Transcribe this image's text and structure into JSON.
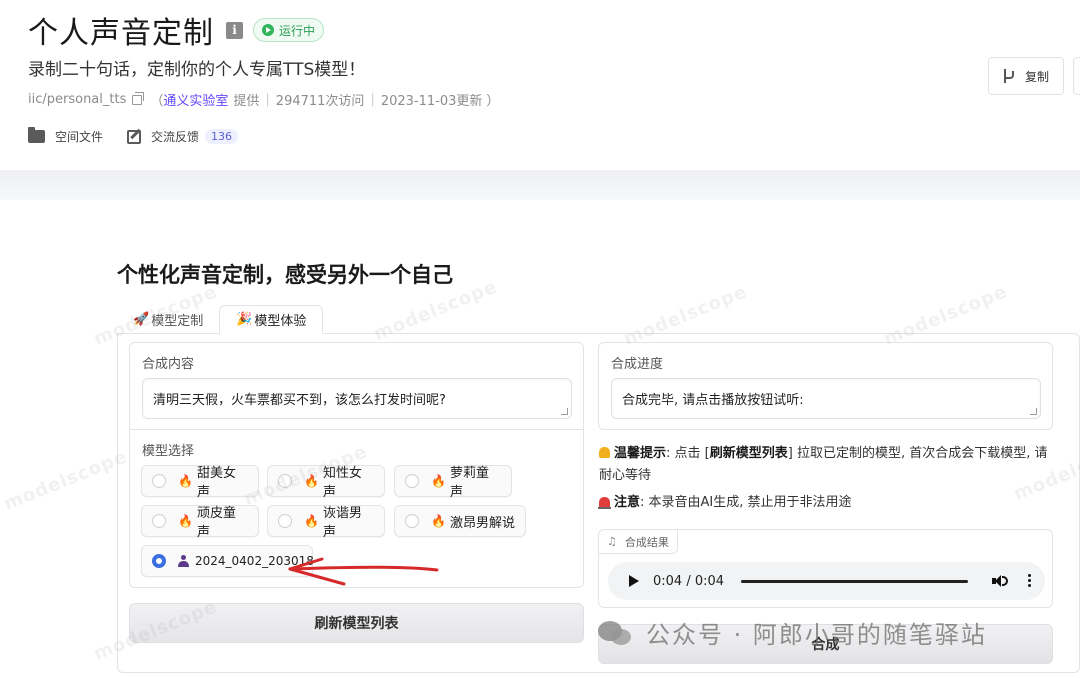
{
  "header": {
    "title": "个人声音定制",
    "info_glyph": "i",
    "status": "运行中",
    "subtitle": "录制二十句话，定制你的个人专属TTS模型！",
    "model_id": "iic/personal_tts",
    "provider_open": "（",
    "provider_name": "通义实验室",
    "provider_suffix": "提供",
    "visits": "294711次访问",
    "updated": "2023-11-03更新",
    "close_paren": "）",
    "links": {
      "files": "空间文件",
      "feedback": "交流反馈",
      "feedback_count": "136"
    },
    "duplicate_button": "复制"
  },
  "app": {
    "title": "个性化声音定制，感受另外一个自己",
    "tabs": [
      {
        "emoji": "🚀",
        "label": "模型定制",
        "active": false
      },
      {
        "emoji": "🎉",
        "label": "模型体验",
        "active": true
      }
    ],
    "synth_content": {
      "label": "合成内容",
      "value": "清明三天假，火车票都买不到，该怎么打发时间呢?"
    },
    "model_select": {
      "label": "模型选择",
      "options": [
        {
          "label": "甜美女声",
          "icon": "fire-icon",
          "selected": false
        },
        {
          "label": "知性女声",
          "icon": "fire-icon",
          "selected": false
        },
        {
          "label": "萝莉童声",
          "icon": "fire-icon",
          "selected": false
        },
        {
          "label": "顽皮童声",
          "icon": "fire-icon",
          "selected": false
        },
        {
          "label": "诙谐男声",
          "icon": "fire-icon",
          "selected": false
        },
        {
          "label": "激昂男解说",
          "icon": "fire-icon",
          "selected": false
        },
        {
          "label": "2024_0402_203018",
          "icon": "user-icon",
          "selected": true
        }
      ]
    },
    "refresh_button": "刷新模型列表",
    "progress": {
      "label": "合成进度",
      "value": "合成完毕, 请点击播放按钮试听:"
    },
    "tips": {
      "warm_label": "温馨提示",
      "warm_pre": ": 点击 [",
      "warm_bold": "刷新模型列表",
      "warm_post": "] 拉取已定制的模型, 首次合成会下载模型, 请耐心等待",
      "notice_label": "注意",
      "notice_text": ": 本录音由AI生成, 禁止用于非法用途"
    },
    "result": {
      "label": "合成结果",
      "time": "0:04 / 0:04",
      "progress_fraction": 1.0
    },
    "synth_button": "合成"
  },
  "overlay": {
    "watermark": "公众号 · 阿郎小哥的随笔驿站",
    "tile_mark": "modelscope",
    "annotation_color": "#d62a2a"
  }
}
